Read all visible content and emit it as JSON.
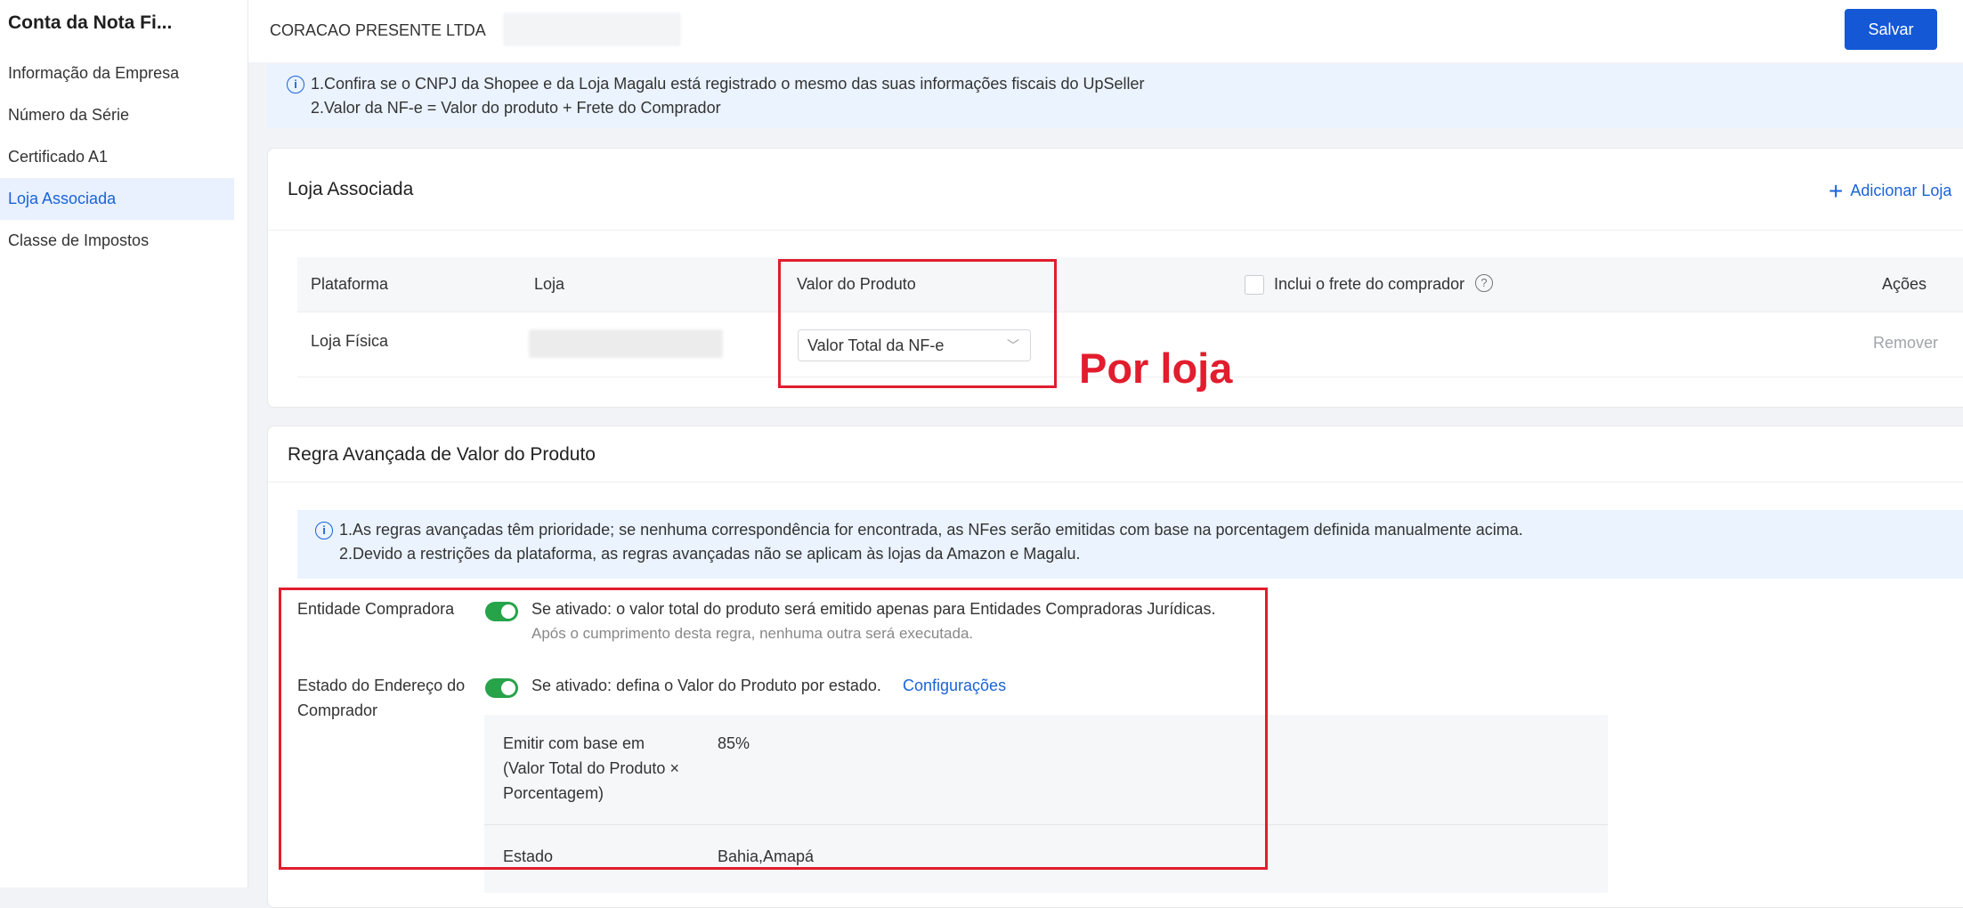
{
  "sidebar": {
    "title": "Conta da Nota Fi...",
    "items": [
      {
        "label": "Informação da Empresa"
      },
      {
        "label": "Número da Série"
      },
      {
        "label": "Certificado A1"
      },
      {
        "label": "Loja Associada"
      },
      {
        "label": "Classe de Impostos"
      }
    ]
  },
  "header": {
    "company": "CORACAO PRESENTE LTDA",
    "save_label": "Salvar"
  },
  "info_top": {
    "line1": "1.Confira se o CNPJ da Shopee e da Loja Magalu está registrado o mesmo das suas informações fiscais do UpSeller",
    "line2": "2.Valor da NF-e = Valor do produto + Frete do Comprador"
  },
  "loja_panel": {
    "title": "Loja Associada",
    "add_label": "Adicionar Loja",
    "columns": {
      "plataforma": "Plataforma",
      "loja": "Loja",
      "valor": "Valor do Produto",
      "frete": "Inclui o frete do comprador",
      "acoes": "Ações"
    },
    "rows": [
      {
        "plataforma": "Loja Física",
        "valor": "Valor Total da NF-e",
        "acao": "Remover"
      }
    ]
  },
  "annotation": "Por loja",
  "regra_panel": {
    "title": "Regra Avançada de Valor do Produto",
    "info_line1": "1.As regras avançadas têm prioridade; se nenhuma correspondência for encontrada, as NFes serão emitidas com base na porcentagem definida manualmente acima.",
    "info_line2": "2.Devido a restrições da plataforma, as regras avançadas não se aplicam às lojas da Amazon e Magalu.",
    "entidade": {
      "label": "Entidade Compradora",
      "desc": "Se ativado: o valor total do produto será emitido apenas para Entidades Compradoras Jurídicas.",
      "note": "Após o cumprimento desta regra, nenhuma outra será executada."
    },
    "estado": {
      "label_1": "Estado do Endereço do",
      "label_2": "Comprador",
      "desc": "Se ativado: defina o Valor do Produto por estado.",
      "link": "Configurações",
      "emitir_1": "Emitir com base em",
      "emitir_2": "(Valor Total do Produto ×",
      "emitir_3": "Porcentagem)",
      "percent": "85%",
      "estado_label": "Estado",
      "estado_value": "Bahia,Amapá"
    }
  }
}
